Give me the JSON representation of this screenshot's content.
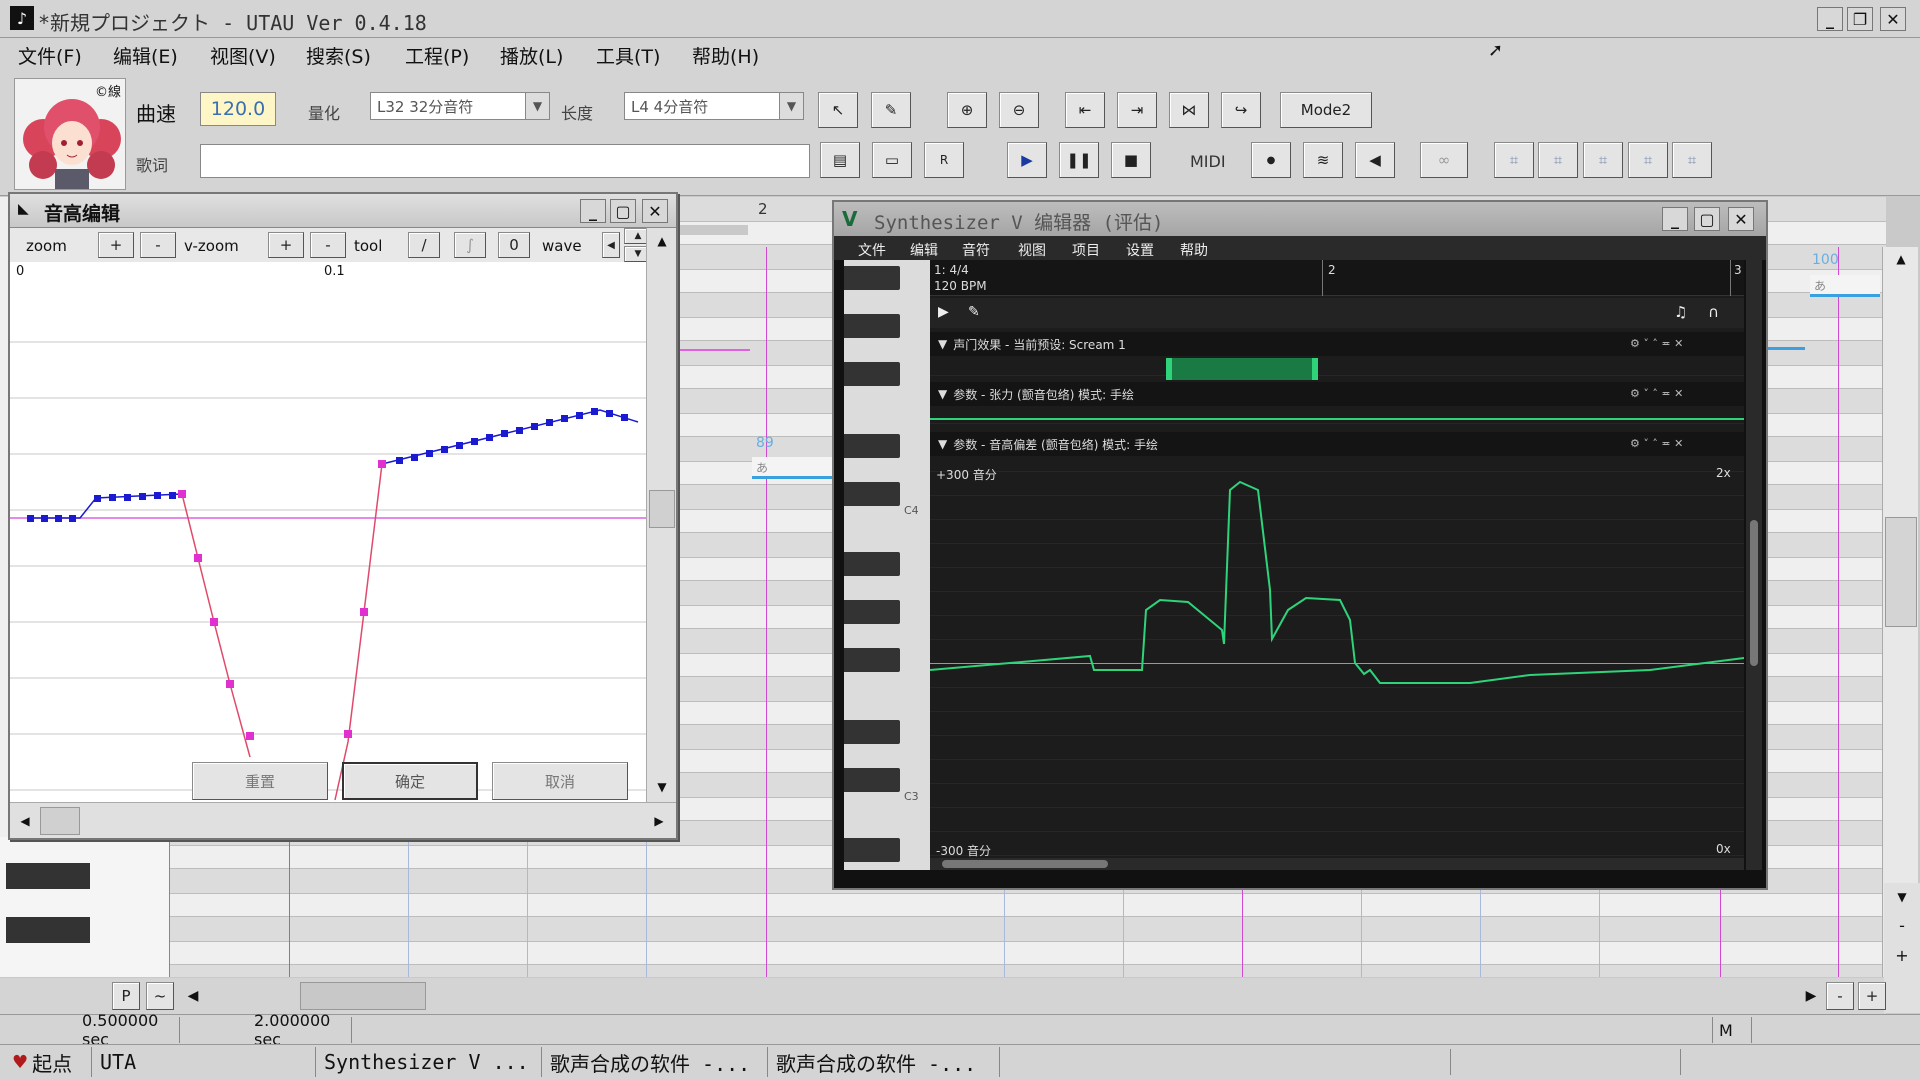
{
  "app": {
    "title": "*新規プロジェクト - UTAU Ver 0.4.18",
    "menu": [
      "文件(F)",
      "编辑(E)",
      "视图(V)",
      "搜索(S)",
      "工程(P)",
      "播放(L)",
      "工具(T)",
      "帮助(H)"
    ]
  },
  "toolbar": {
    "tempo_label": "曲速",
    "tempo_value": "120.0",
    "quantize_label": "量化",
    "quantize_value": "L32 32分音符",
    "length_label": "长度",
    "length_value": "L4 4分音符",
    "lyric_label": "歌词",
    "lyric_value": "",
    "mode_button": "Mode2",
    "midi_label": "MIDI",
    "avatar_copyright": "©線"
  },
  "piano_roll": {
    "measure_2": "2",
    "note_number_89": "89",
    "note_number_100": "100",
    "note_lyric": "あ"
  },
  "pitch_editor": {
    "title": "音高编辑",
    "zoom_label": "zoom",
    "plus": "+",
    "minus": "-",
    "vzoom_label": "v-zoom",
    "tool_label": "tool",
    "tool_line": "/",
    "tool_curve": "∫",
    "tool_zero": "0",
    "wave_label": "wave",
    "ruler_0": "0",
    "ruler_01": "0.1",
    "reset_button": "重置",
    "ok_button": "确定",
    "cancel_button": "取消"
  },
  "synth_v": {
    "title": "Synthesizer V 编辑器 (评估)",
    "menu": [
      "文件",
      "编辑",
      "音符",
      "视图",
      "项目",
      "设置",
      "帮助"
    ],
    "time_sig": "1: 4/4",
    "bpm": "120 BPM",
    "bar_2": "2",
    "bar_3": "3",
    "track1": "声门效果 - 当前预设: Scream 1",
    "track2": "参数 - 张力 (颤音包络) 模式: 手绘",
    "track3": "参数 - 音高偏差 (颤音包络) 模式: 手绘",
    "plus300": "+300 音分",
    "minus300": "-300 音分",
    "scale_2x": "2x",
    "scale_0x": "0x",
    "key_c4": "C4",
    "key_c3": "C3",
    "curve_color": "#2fd47a"
  },
  "bottom": {
    "p_button": "P",
    "tilde_button": "~",
    "time_left": "0.500000 sec",
    "time_right": "2.000000 sec",
    "m_label": "M",
    "zoom_minus": "-",
    "zoom_plus": "+"
  },
  "taskbar": {
    "start": "起点",
    "items": [
      "UTA",
      "Synthesizer V ...",
      "歌声合成の软件 -...",
      "歌声合成の软件 -..."
    ]
  }
}
